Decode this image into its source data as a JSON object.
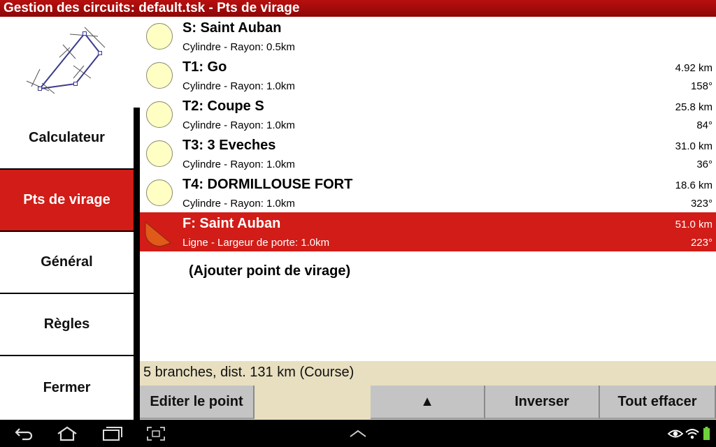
{
  "title": "Gestion des circuits: default.tsk - Pts de virage",
  "sidebar": {
    "tabs": [
      {
        "label": "Calculateur",
        "active": false
      },
      {
        "label": "Pts de virage",
        "active": true
      },
      {
        "label": "Général",
        "active": false
      },
      {
        "label": "Règles",
        "active": false
      },
      {
        "label": "Fermer",
        "active": false
      }
    ]
  },
  "turnpoints": [
    {
      "name": "S: Saint Auban",
      "detail": "Cylindre - Rayon: 0.5km",
      "distance": "",
      "bearing": "",
      "icon": "cylinder-icon",
      "selected": false
    },
    {
      "name": "T1: Go",
      "detail": "Cylindre - Rayon: 1.0km",
      "distance": "4.92 km",
      "bearing": "158°",
      "icon": "cylinder-icon",
      "selected": false
    },
    {
      "name": "T2: Coupe S",
      "detail": "Cylindre - Rayon: 1.0km",
      "distance": "25.8 km",
      "bearing": "84°",
      "icon": "cylinder-icon",
      "selected": false
    },
    {
      "name": "T3: 3 Eveches",
      "detail": "Cylindre - Rayon: 1.0km",
      "distance": "31.0 km",
      "bearing": "36°",
      "icon": "cylinder-icon",
      "selected": false
    },
    {
      "name": "T4: DORMILLOUSE FORT",
      "detail": "Cylindre - Rayon: 1.0km",
      "distance": "18.6 km",
      "bearing": "323°",
      "icon": "cylinder-icon",
      "selected": false
    },
    {
      "name": "F: Saint Auban",
      "detail": "Ligne - Largeur de porte: 1.0km",
      "distance": "51.0 km",
      "bearing": "223°",
      "icon": "finish-line-icon",
      "selected": true
    }
  ],
  "add_point_label": "(Ajouter point de virage)",
  "summary": "5 branches, dist. 131 km (Course)",
  "buttons": {
    "edit": "Editer le point",
    "move_up": "▲",
    "reverse": "Inverser",
    "clear_all": "Tout effacer"
  },
  "colors": {
    "title_bar": "#a00c0c",
    "accent_red": "#d11c17",
    "cylinder_fill": "#ffffc4",
    "finish_icon": "#e05a1a",
    "summary_bg": "#e8dfc0",
    "button_bg": "#c4c4c4"
  },
  "navbar_icons": [
    "back-icon",
    "home-icon",
    "recent-apps-icon",
    "screenshot-icon",
    "up-chevron-icon",
    "eye-icon",
    "wifi-icon",
    "battery-icon"
  ]
}
